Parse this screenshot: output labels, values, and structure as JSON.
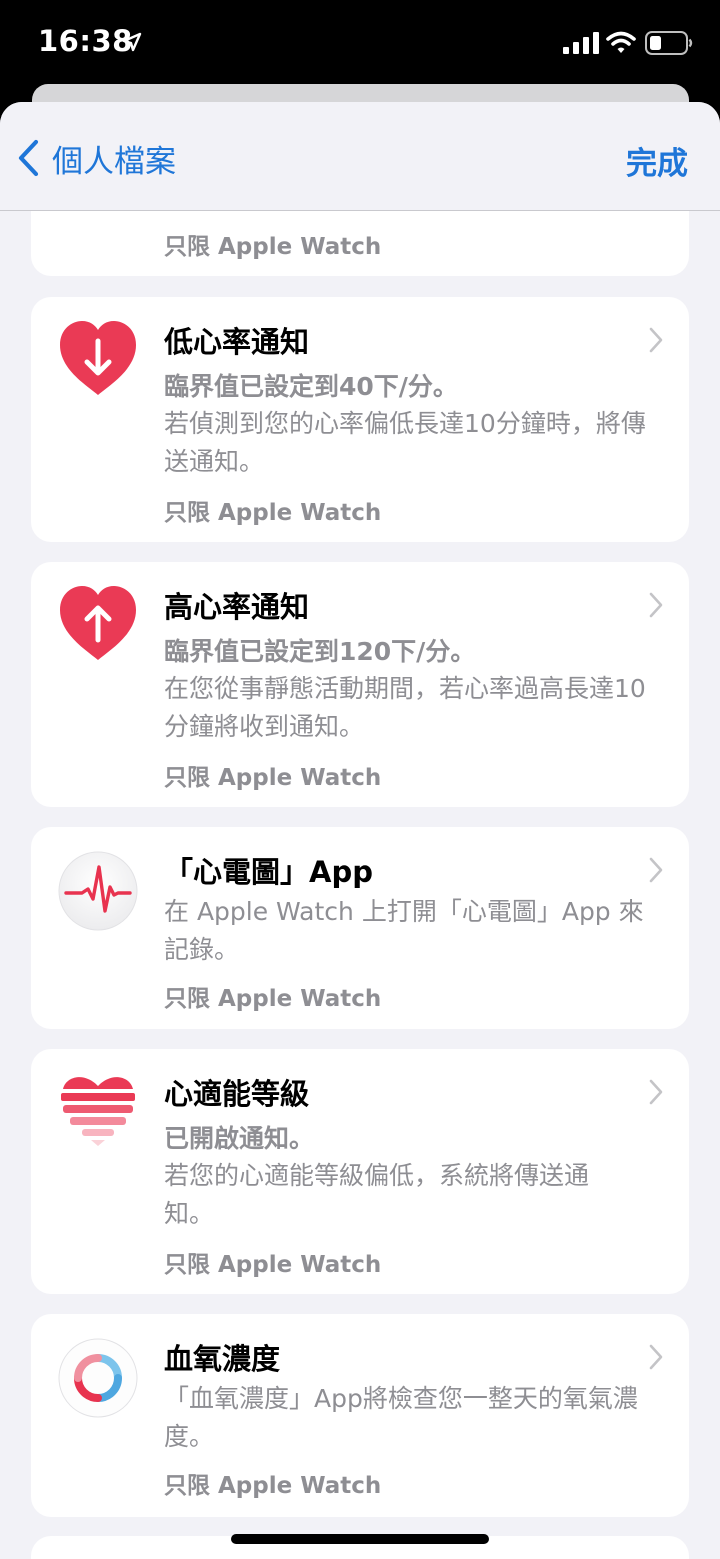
{
  "status": {
    "time": "16:38"
  },
  "nav": {
    "back_label": "個人檔案",
    "done_label": "完成"
  },
  "top_card": {
    "only_label": "只限 Apple Watch"
  },
  "cards": [
    {
      "title": "低心率通知",
      "sub": "臨界值已設定到40下/分。",
      "desc": "若偵測到您的心率偏低長達10分鐘時，將傳送通知。",
      "only": "只限 Apple Watch",
      "icon": "heart-arrow-down-icon"
    },
    {
      "title": "高心率通知",
      "sub": "臨界值已設定到120下/分。",
      "desc": "在您從事靜態活動期間，若心率過高長達10分鐘將收到通知。",
      "only": "只限 Apple Watch",
      "icon": "heart-arrow-up-icon"
    },
    {
      "title": "「心電圖」App",
      "desc": "在 Apple Watch 上打開「心電圖」App 來記錄。",
      "only": "只限 Apple Watch",
      "icon": "ecg-app-icon"
    },
    {
      "title": "心適能等級",
      "sub": "已開啟通知。",
      "desc": "若您的心適能等級偏低，系統將傳送通知。",
      "only": "只限 Apple Watch",
      "icon": "cardio-fitness-icon"
    },
    {
      "title": "血氧濃度",
      "desc": "「血氧濃度」App將檢查您一整天的氧氣濃度。",
      "only": "只限 Apple Watch",
      "icon": "blood-oxygen-icon"
    }
  ],
  "colors": {
    "accent": "#1f76d8",
    "heart": "#ea3a55",
    "secondary": "#8e8e93",
    "background": "#f2f2f7"
  }
}
